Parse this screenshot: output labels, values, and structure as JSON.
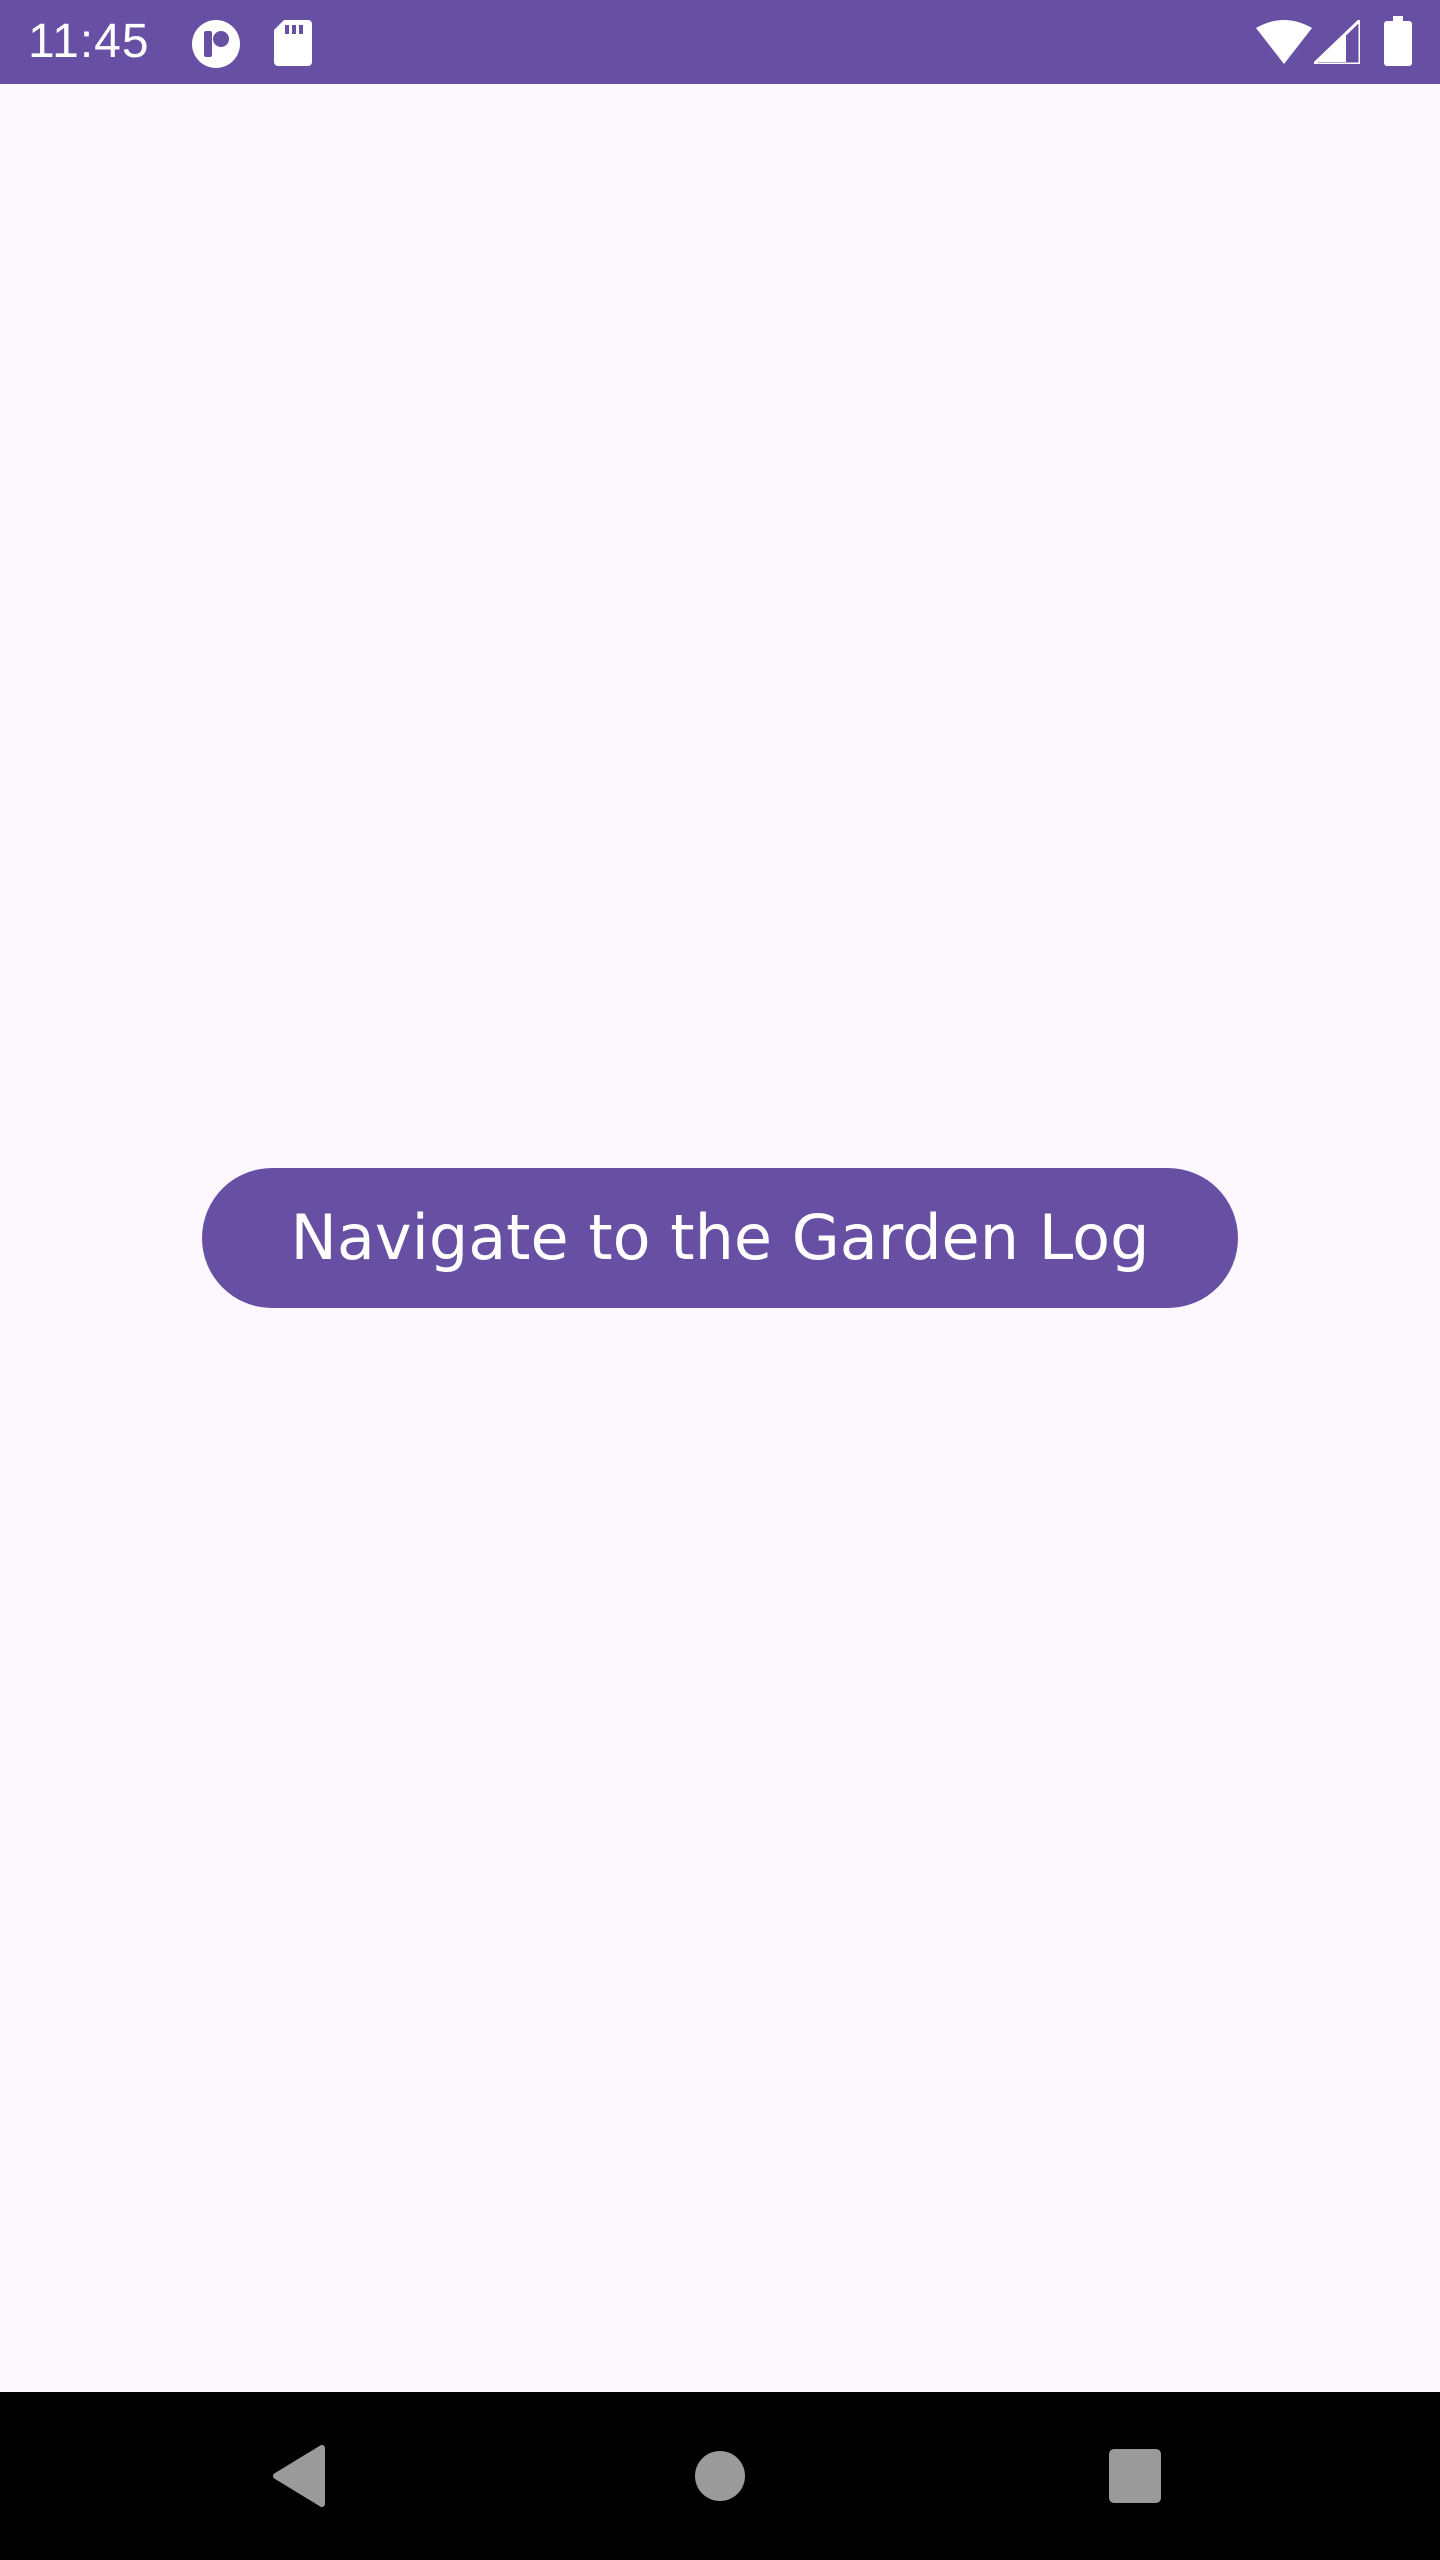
{
  "status_bar": {
    "time": "11:45",
    "background_color": "#6750a4",
    "left_icons": [
      "notification-app-icon",
      "sd-card-icon"
    ],
    "right_icons": [
      "wifi-icon",
      "cellular-signal-icon",
      "battery-icon"
    ]
  },
  "main": {
    "background_color": "#fdf7fe",
    "navigate_button_label": "Navigate to the Garden Log",
    "button_color": "#6750a4",
    "button_text_color": "#ffffff"
  },
  "nav_bar": {
    "background_color": "#000000",
    "buttons": [
      "back-icon",
      "home-icon",
      "recents-icon"
    ]
  }
}
